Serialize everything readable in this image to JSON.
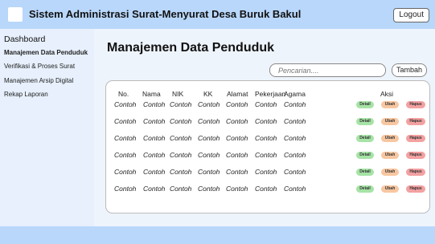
{
  "header": {
    "title": "Sistem Administrasi Surat-Menyurat Desa Buruk Bakul",
    "logout_label": "Logout"
  },
  "sidebar": {
    "items": [
      {
        "label": "Dashboard"
      },
      {
        "label": "Manajemen Data Penduduk"
      },
      {
        "label": "Verifikasi & Proses Surat"
      },
      {
        "label": "Manajemen Arsip Digital"
      },
      {
        "label": "Rekap Laporan"
      }
    ]
  },
  "main": {
    "page_title": "Manajemen Data Penduduk",
    "search_placeholder": "Pencarian....",
    "add_label": "Tambah"
  },
  "table": {
    "headers": [
      "No.",
      "Nama",
      "NIK",
      "KK",
      "Alamat",
      "Pekerjaan",
      "Agama",
      "Aksi"
    ],
    "rows": [
      [
        "Contoh",
        "Contoh",
        "Contoh",
        "Contoh",
        "Contoh",
        "Contoh",
        "Contoh"
      ],
      [
        "Contoh",
        "Contoh",
        "Contoh",
        "Contoh",
        "Contoh",
        "Contoh",
        "Contoh"
      ],
      [
        "Contoh",
        "Contoh",
        "Contoh",
        "Contoh",
        "Contoh",
        "Contoh",
        "Contoh"
      ],
      [
        "Contoh",
        "Contoh",
        "Contoh",
        "Contoh",
        "Contoh",
        "Contoh",
        "Contoh"
      ],
      [
        "Contoh",
        "Contoh",
        "Contoh",
        "Contoh",
        "Contoh",
        "Contoh",
        "Contoh"
      ],
      [
        "Contoh",
        "Contoh",
        "Contoh",
        "Contoh",
        "Contoh",
        "Contoh",
        "Contoh"
      ]
    ],
    "actions": {
      "detail": "Detail",
      "edit": "Ubah",
      "delete": "Hapus"
    }
  },
  "colors": {
    "header_bg": "#b8d7fb",
    "sidebar_bg": "#e7f0fc",
    "detail": "#a6e3a6",
    "edit": "#f7c7a1",
    "delete": "#f3a1a1"
  }
}
